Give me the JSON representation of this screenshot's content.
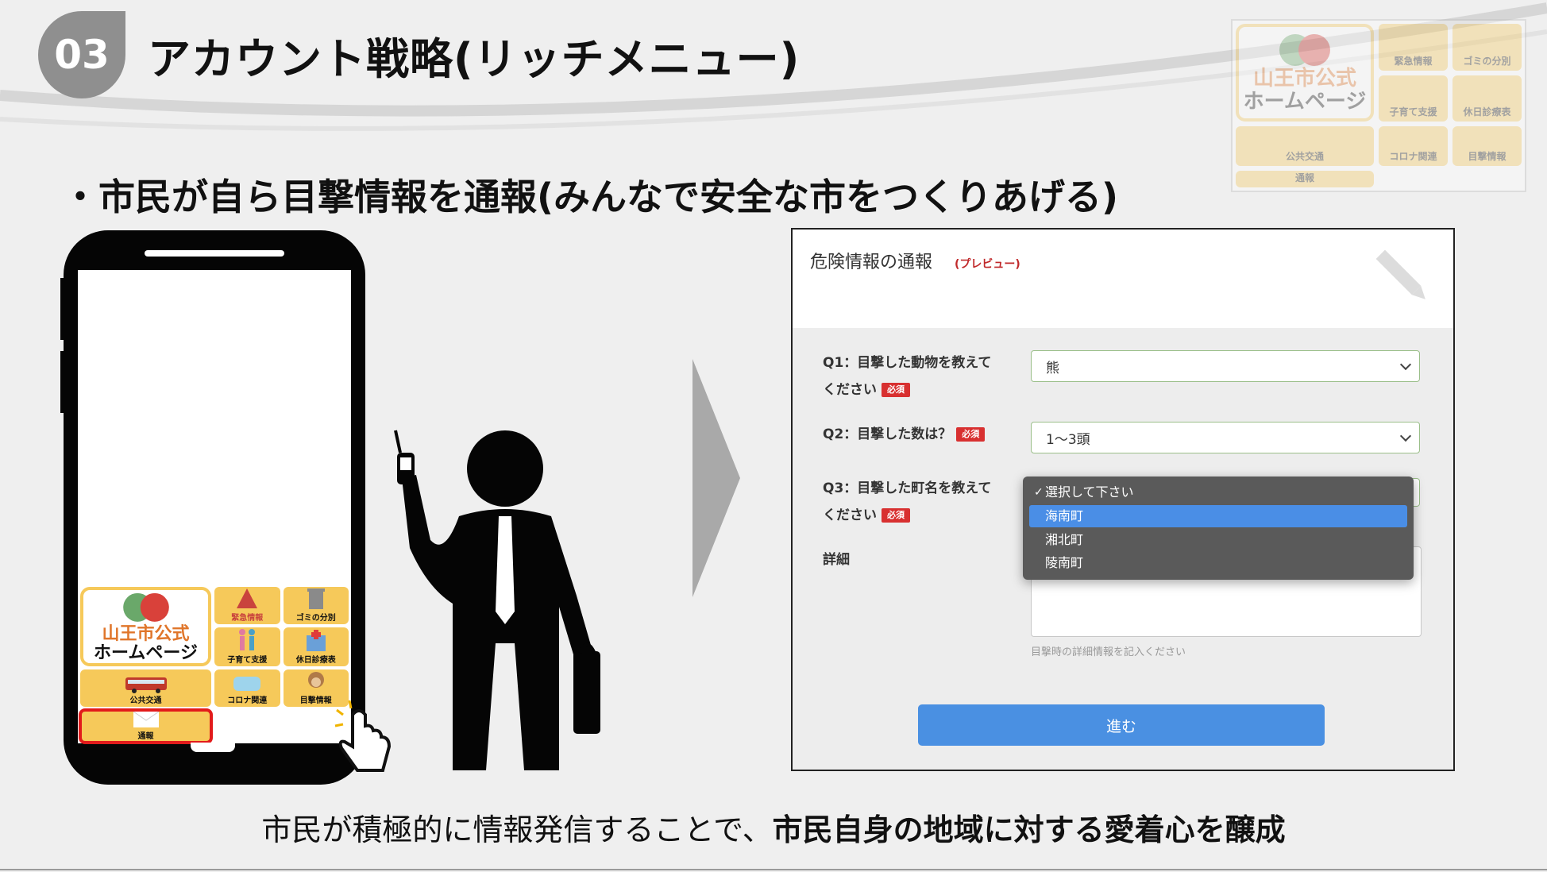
{
  "header": {
    "badge_number": "03",
    "title": "アカウント戦略(リッチメニュー)"
  },
  "subtitle": "・市民が自ら目撃情報を通報(みんなで安全な市をつくりあげる)",
  "rich_menu": {
    "city_line1": "山王市公式",
    "city_line2": "ホームページ",
    "items": [
      "緊急情報",
      "ゴミの分別",
      "子育て支援",
      "休日診療表",
      "公共交通",
      "コロナ関連",
      "目撃情報",
      "通報"
    ]
  },
  "form": {
    "title": "危険情報の通報",
    "tag": "(プレビュー)",
    "required_badge": "必須",
    "q1": {
      "label_line1": "Q1：目撃した動物を教えて",
      "label_line2": "ください",
      "value": "熊"
    },
    "q2": {
      "label": "Q2：目撃した数は？",
      "value": "1〜3頭"
    },
    "q3": {
      "label_line1": "Q3：目撃した町名を教えて",
      "label_line2": "ください",
      "options": [
        "選択して下さい",
        "海南町",
        "湘北町",
        "陵南町"
      ],
      "selected_option": "選択して下さい",
      "highlighted_option": "海南町"
    },
    "detail_label": "詳細",
    "detail_help": "目撃時の詳細情報を記入ください",
    "submit_label": "進む"
  },
  "footer": {
    "text_plain": "市民が積極的に情報発信することで、",
    "text_bold": "市民自身の地域に対する愛着心を醸成"
  },
  "colors": {
    "accent_blue": "#4a90e2",
    "required_red": "#d83030",
    "menu_yellow": "#f6c95a",
    "highlight_red": "#e21b1b"
  }
}
